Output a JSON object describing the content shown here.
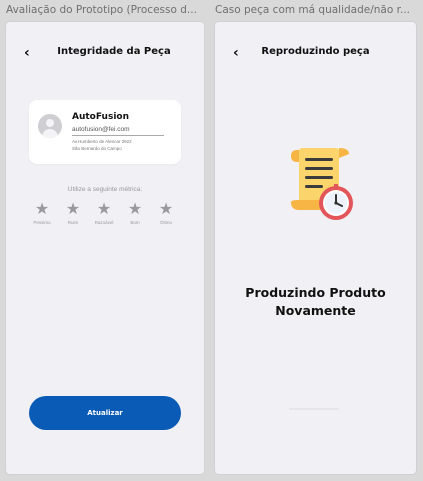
{
  "frames": [
    {
      "label": "Avaliação do Prototipo (Processo d..."
    },
    {
      "label": "Caso peça com má qualidade/não r..."
    }
  ],
  "screen1": {
    "back_glyph": "‹",
    "title": "Integridade da Peça",
    "card": {
      "company": "AutoFusion",
      "email": "autofusion@fei.com",
      "address_line1": "Av.Humberto de Alencar 3922",
      "address_line2": "São Bernardo do Campo"
    },
    "metric_label": "Utilize a seguinte métrica:",
    "ratings": [
      {
        "icon": "star-icon",
        "label": "Pessimo"
      },
      {
        "icon": "star-icon",
        "label": "Ruim"
      },
      {
        "icon": "star-icon",
        "label": "Razoável"
      },
      {
        "icon": "star-icon",
        "label": "Bom"
      },
      {
        "icon": "star-icon",
        "label": "Ótimo"
      }
    ],
    "button_label": "Atualizar",
    "button_color": "#0a5bb5"
  },
  "screen2": {
    "back_glyph": "‹",
    "title": "Reproduzindo peça",
    "illustration": "scroll-with-clock-icon",
    "message_line1": "Produzindo Produto",
    "message_line2": "Novamente"
  }
}
